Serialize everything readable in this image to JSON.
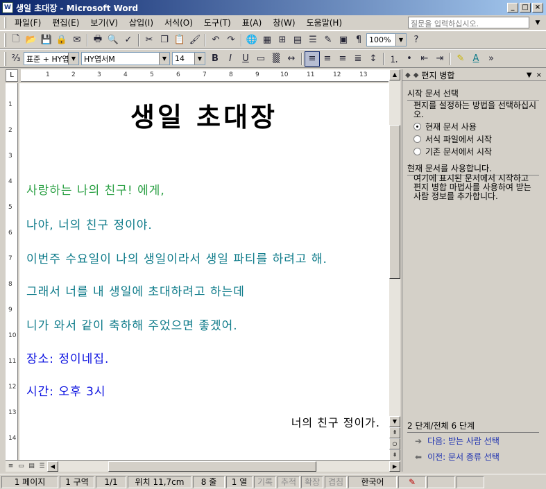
{
  "window": {
    "title": "생일 초대장 - Microsoft Word",
    "icon": "W"
  },
  "menu": {
    "items": [
      "파일(F)",
      "편집(E)",
      "보기(V)",
      "삽입(I)",
      "서식(O)",
      "도구(T)",
      "표(A)",
      "창(W)",
      "도움말(H)"
    ],
    "help_placeholder": "질문을 입력하십시오."
  },
  "toolbar": {
    "zoom": "100%",
    "style": "표준 + HY엽",
    "font": "HY엽서M",
    "size": "14"
  },
  "ruler": {
    "h": [
      "1",
      "2",
      "3",
      "4",
      "5",
      "6",
      "7",
      "8",
      "9",
      "10",
      "11",
      "12",
      "13"
    ],
    "v": [
      "1",
      "2",
      "3",
      "4",
      "5",
      "6",
      "7",
      "8",
      "9",
      "10",
      "11",
      "12",
      "13",
      "14"
    ]
  },
  "document": {
    "title": "생일 초대장",
    "lines": [
      "사랑하는 나의 친구! 에게,",
      "나야, 너의 친구 정이야.",
      "이번주 수요일이 나의 생일이라서 생일 파티를 하려고 해.",
      "그래서 너를 내 생일에 초대하려고 하는데",
      "니가 와서 같이 축하해 주었으면 좋겠어.",
      "장소: 정이네집.",
      "시간: 오후 3시"
    ],
    "signoff": "너의 친구 정이가."
  },
  "taskpane": {
    "title": "편지 병합",
    "section1": "시작 문서 선택",
    "desc1": "편지를 설정하는 방법을 선택하십시오.",
    "options": [
      "현재 문서 사용",
      "서식 파일에서 시작",
      "기존 문서에서 시작"
    ],
    "section2": "현재 문서를 사용합니다.",
    "desc2": "여기에 표시된 문서에서 시작하고 편지 병합 마법사를 사용하여 받는 사람 정보를 추가합니다.",
    "step": "2 단계/전체 6 단계",
    "next": "다음: 받는 사람 선택",
    "prev": "이전: 문서 종류 선택"
  },
  "status": {
    "page": "1 페이지",
    "section": "1 구역",
    "pages": "1/1",
    "position": "위치 11,7cm",
    "line": "8 줄",
    "col": "1 열",
    "rec": "기록",
    "trk": "추적",
    "ext": "확장",
    "ovr": "겹침",
    "lang": "한국어"
  }
}
